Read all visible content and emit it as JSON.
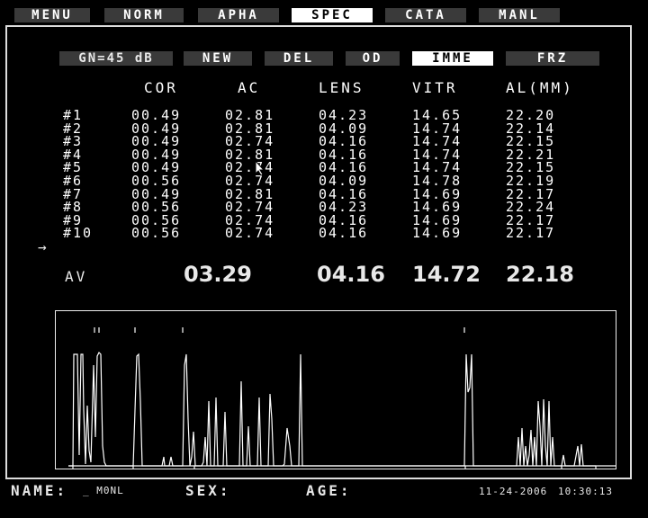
{
  "menu": {
    "tabs": [
      {
        "label": "MENU"
      },
      {
        "label": "NORM"
      },
      {
        "label": "APHA"
      },
      {
        "label": "SPEC"
      },
      {
        "label": "CATA"
      },
      {
        "label": "MANL"
      }
    ],
    "active": "SPEC"
  },
  "toolbar": {
    "gain": "GN=45 dB",
    "buttons": [
      {
        "label": "NEW"
      },
      {
        "label": "DEL"
      },
      {
        "label": "OD"
      },
      {
        "label": "IMME"
      },
      {
        "label": "FRZ"
      }
    ],
    "active": "IMME"
  },
  "table": {
    "headers": [
      "COR",
      "AC",
      "LENS",
      "VITR",
      "AL(MM)"
    ],
    "rows": [
      {
        "id": "#1",
        "cor": "00.49",
        "ac": "02.81",
        "lens": "04.23",
        "vitr": "14.65",
        "al": "22.20"
      },
      {
        "id": "#2",
        "cor": "00.49",
        "ac": "02.81",
        "lens": "04.09",
        "vitr": "14.74",
        "al": "22.14"
      },
      {
        "id": "#3",
        "cor": "00.49",
        "ac": "02.74",
        "lens": "04.16",
        "vitr": "14.74",
        "al": "22.15"
      },
      {
        "id": "#4",
        "cor": "00.49",
        "ac": "02.81",
        "lens": "04.16",
        "vitr": "14.74",
        "al": "22.21"
      },
      {
        "id": "#5",
        "cor": "00.49",
        "ac": "02.74",
        "lens": "04.16",
        "vitr": "14.74",
        "al": "22.15"
      },
      {
        "id": "#6",
        "cor": "00.56",
        "ac": "02.74",
        "lens": "04.09",
        "vitr": "14.78",
        "al": "22.19"
      },
      {
        "id": "#7",
        "cor": "00.49",
        "ac": "02.81",
        "lens": "04.16",
        "vitr": "14.69",
        "al": "22.17"
      },
      {
        "id": "#8",
        "cor": "00.56",
        "ac": "02.74",
        "lens": "04.23",
        "vitr": "14.69",
        "al": "22.24"
      },
      {
        "id": "#9",
        "cor": "00.56",
        "ac": "02.74",
        "lens": "04.16",
        "vitr": "14.69",
        "al": "22.17"
      },
      {
        "id": "#10",
        "cor": "00.56",
        "ac": "02.74",
        "lens": "04.16",
        "vitr": "14.69",
        "al": "22.17"
      }
    ],
    "selected_row": "#10",
    "avg_label": "AV",
    "avg": {
      "ac": "03.29",
      "lens": "04.16",
      "vitr": "14.72",
      "al": "22.18"
    }
  },
  "footer": {
    "name_label": "NAME:",
    "name_value": "_ M0NL",
    "sex_label": "SEX:",
    "age_label": "AGE:",
    "date": "11-24-2006",
    "time": "10:30:13"
  },
  "icons": {
    "row_marker": "arrow-right-icon",
    "pointer": "mouse-cursor-icon"
  }
}
